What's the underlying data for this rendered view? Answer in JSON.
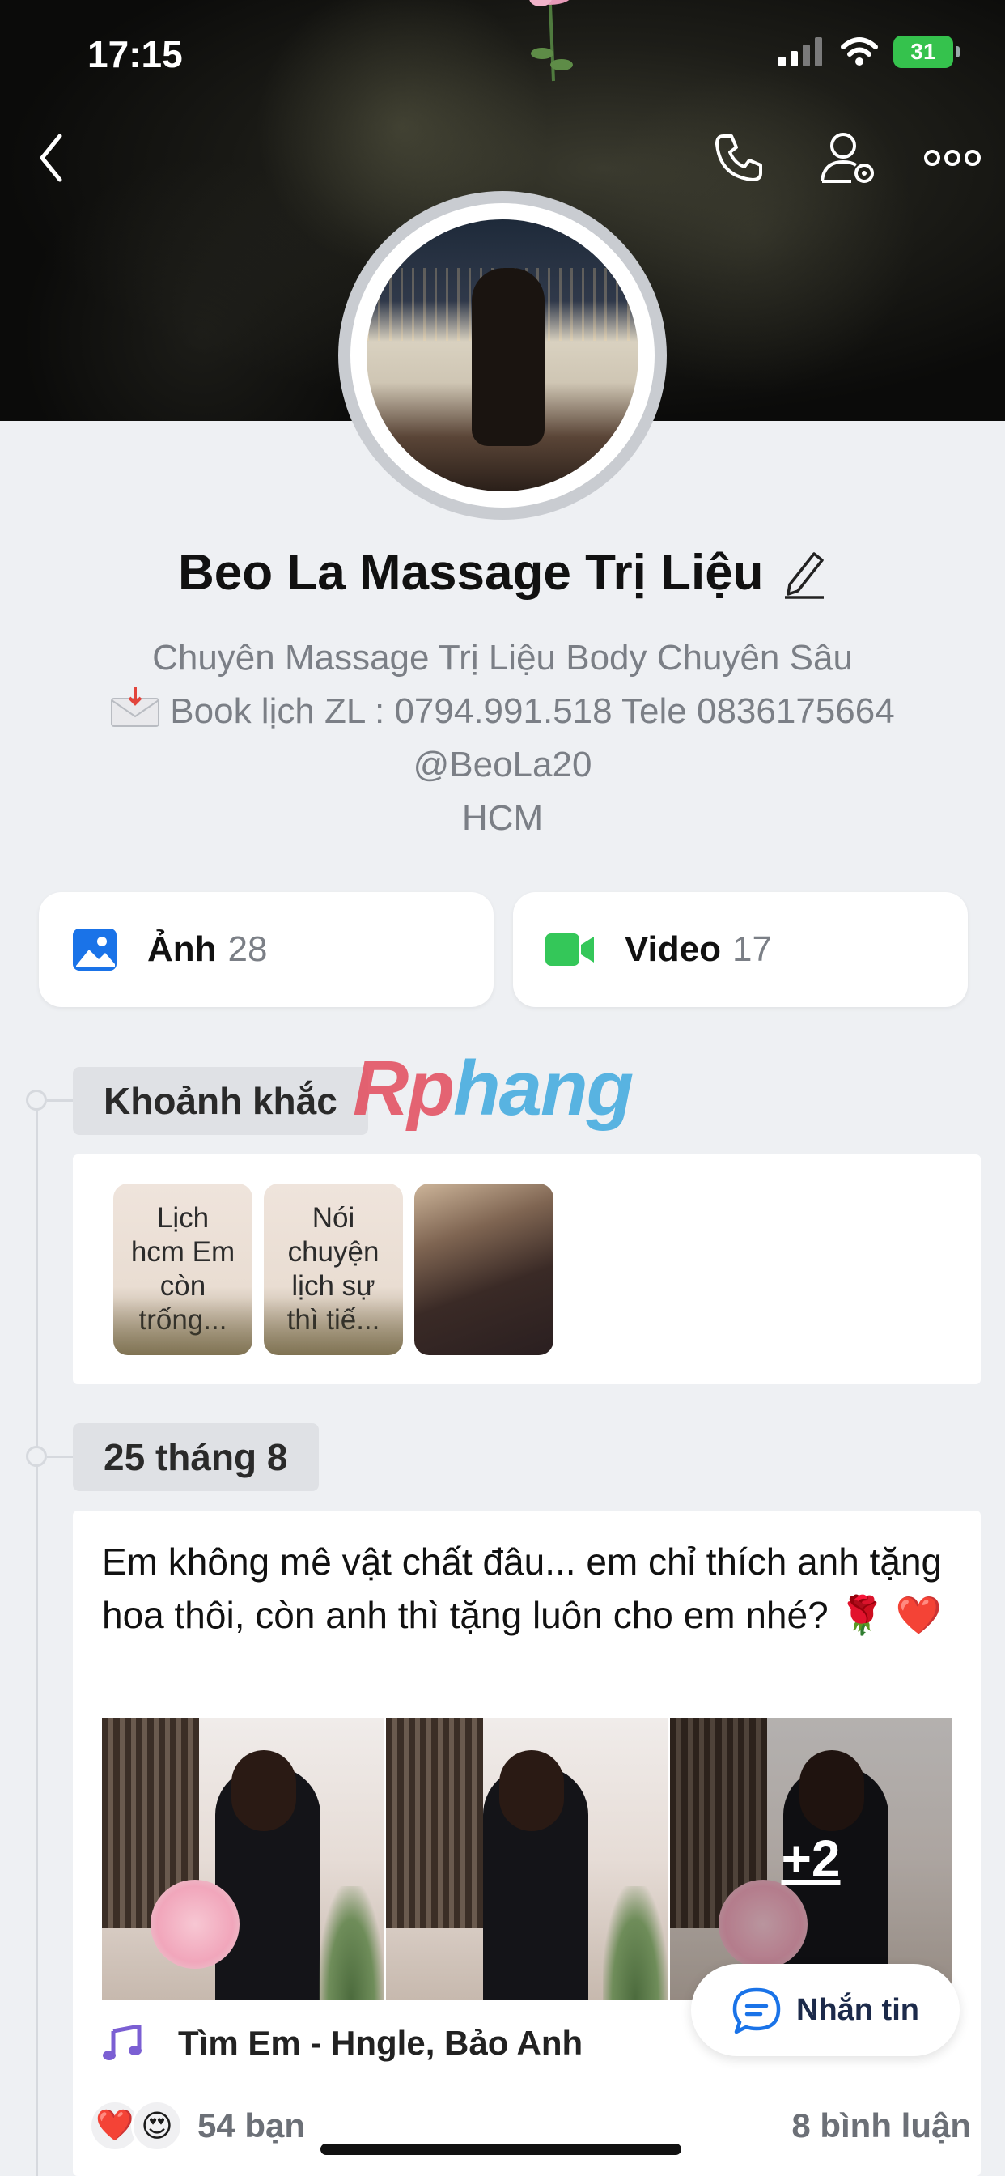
{
  "status_bar": {
    "time": "17:15",
    "battery": "31"
  },
  "header": {
    "icons": [
      "back-icon",
      "phone-icon",
      "user-settings-icon",
      "more-icon"
    ]
  },
  "profile": {
    "name": "Beo La Massage Trị Liệu",
    "bio_lines": [
      "Chuyên Massage Trị Liệu Body Chuyên Sâu",
      "Book lịch ZL : 0794.991.518 Tele 0836175664",
      "@BeoLa20",
      "HCM"
    ]
  },
  "media": {
    "photos": {
      "label": "Ảnh",
      "count": "28"
    },
    "videos": {
      "label": "Video",
      "count": "17"
    }
  },
  "watermark": {
    "part1": "Rp",
    "part2": "hang"
  },
  "moments": {
    "title": "Khoảnh khắc",
    "items": [
      {
        "text": "Lịch hcm Em còn trống..."
      },
      {
        "text": "Nói chuyện lịch sự thì tiế..."
      },
      {
        "text": ""
      }
    ]
  },
  "post": {
    "date": "25 tháng 8",
    "text": "Em không mê vật chất đâu... em chỉ thích anh tặng hoa thôi, còn anh thì tặng luôn cho em nhé? 🌹 ❤️",
    "more_photos": "+2",
    "music": "Tìm Em - Hngle, Bảo Anh",
    "reactions": [
      "❤️",
      "😍"
    ],
    "reaction_count": "54 bạn",
    "comment_count": "8 bình luận"
  },
  "message_button": {
    "label": "Nhắn tin"
  },
  "colors": {
    "accent_blue": "#1a73e8",
    "video_green": "#34c759",
    "battery_green": "#35c24d"
  }
}
